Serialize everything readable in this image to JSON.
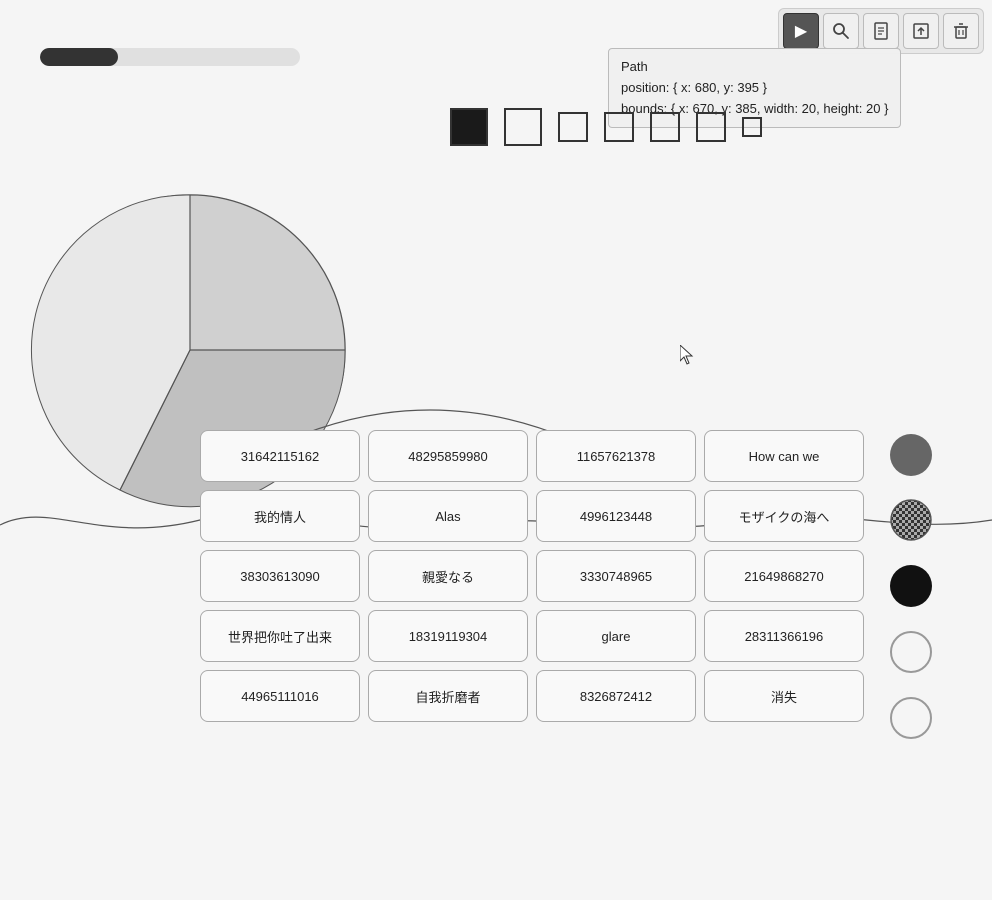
{
  "toolbar": {
    "tools": [
      {
        "name": "select",
        "label": "▲",
        "active": true
      },
      {
        "name": "search",
        "label": "⌕",
        "active": false
      },
      {
        "name": "pdf",
        "label": "📄",
        "active": false
      },
      {
        "name": "export",
        "label": "⬜",
        "active": false
      },
      {
        "name": "delete",
        "label": "🗑",
        "active": false
      }
    ]
  },
  "progress": {
    "value": 30
  },
  "info_box": {
    "title": "Path",
    "position": "position: { x: 680, y: 395 }",
    "bounds": "bounds: { x: 670, y: 385, width: 20, height: 20 }"
  },
  "shapes": [
    {
      "type": "filled-large",
      "size": "lg"
    },
    {
      "type": "outline-large",
      "size": "lg"
    },
    {
      "type": "outline-medium",
      "size": "md"
    },
    {
      "type": "outline-medium2",
      "size": "md"
    },
    {
      "type": "outline-medium3",
      "size": "md"
    },
    {
      "type": "outline-medium4",
      "size": "md"
    },
    {
      "type": "outline-small",
      "size": "sm"
    }
  ],
  "grid": {
    "rows": [
      [
        "31642115162",
        "48295859980",
        "11657621378",
        "How can we"
      ],
      [
        "我的情人",
        "Alas",
        "4996123448",
        "モザイクの海へ"
      ],
      [
        "38303613090",
        "親愛なる",
        "3330748965",
        "21649868270"
      ],
      [
        "世界把你吐了出来",
        "18319119304",
        "glare",
        "28311366196"
      ],
      [
        "44965111016",
        "自我折磨者",
        "8326872412",
        "消失"
      ]
    ]
  },
  "circles": [
    {
      "id": "dark-gray",
      "color": "#666666"
    },
    {
      "id": "checkered",
      "color": "checkered"
    },
    {
      "id": "black",
      "color": "#111111"
    },
    {
      "id": "white1",
      "color": "#f5f5f5"
    },
    {
      "id": "white2",
      "color": "#f5f5f5"
    }
  ]
}
